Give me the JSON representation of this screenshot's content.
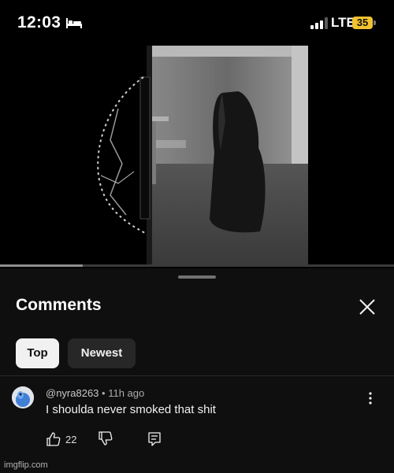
{
  "status_bar": {
    "time": "12:03",
    "network": "LTE",
    "battery": "35",
    "battery_color": "#f2c230"
  },
  "video": {
    "progress": 0.21,
    "progress_color": "#8f8f8f"
  },
  "comments_panel": {
    "title": "Comments",
    "filters": [
      "Top",
      "Newest"
    ],
    "selected_filter": "Top"
  },
  "comment": {
    "username": "@nyra8263",
    "separator": "•",
    "time_ago": "11h ago",
    "text": "I shoulda never smoked that shit",
    "likes": "22"
  },
  "watermark": "imgflip.com",
  "icons": [
    "bed-icon",
    "signal-icon",
    "close-icon",
    "more-vertical-icon",
    "thumbs-up-icon",
    "thumbs-down-icon",
    "reply-icon"
  ]
}
